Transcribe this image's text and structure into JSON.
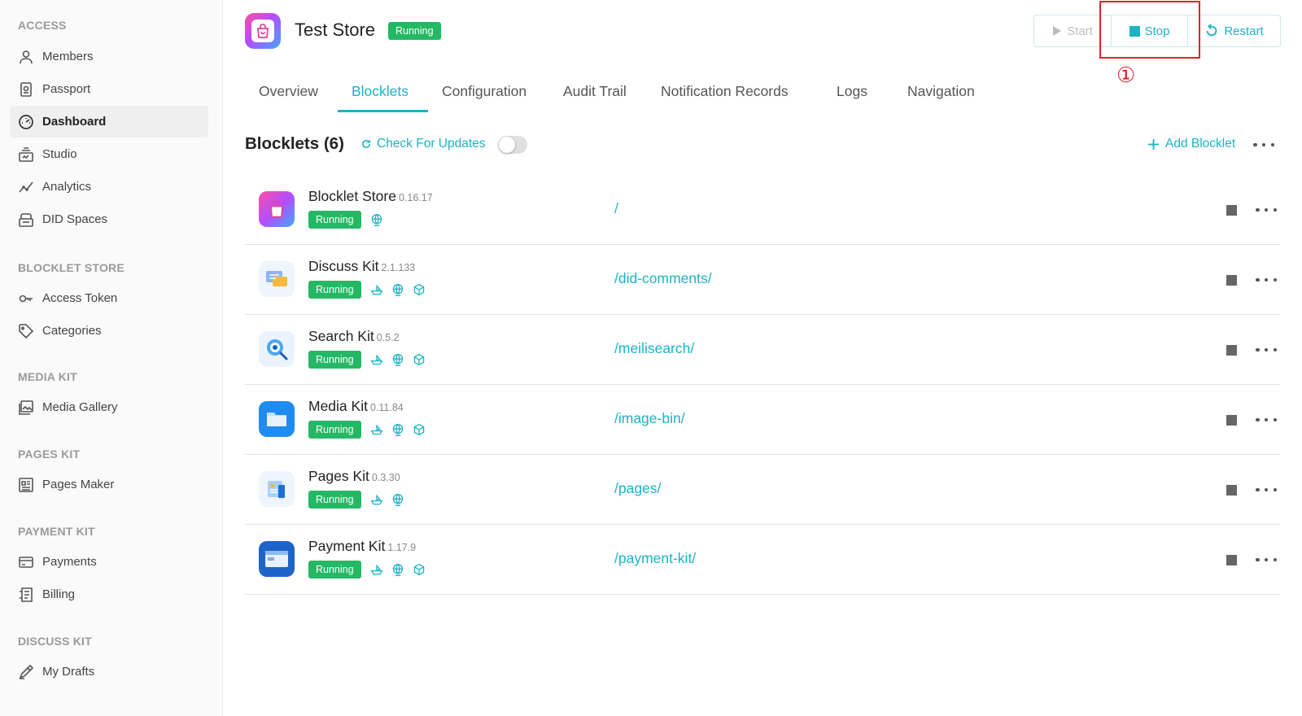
{
  "sidebar": {
    "sections": [
      {
        "header": "ACCESS",
        "items": [
          {
            "label": "Members",
            "icon": "person-icon"
          },
          {
            "label": "Passport",
            "icon": "passport-icon"
          },
          {
            "label": "Dashboard",
            "icon": "dashboard-gauge-icon",
            "active": true
          },
          {
            "label": "Studio",
            "icon": "studio-icon"
          },
          {
            "label": "Analytics",
            "icon": "analytics-icon"
          },
          {
            "label": "DID Spaces",
            "icon": "did-spaces-icon"
          }
        ]
      },
      {
        "header": "BLOCKLET STORE",
        "items": [
          {
            "label": "Access Token",
            "icon": "key-icon"
          },
          {
            "label": "Categories",
            "icon": "tag-icon"
          }
        ]
      },
      {
        "header": "MEDIA KIT",
        "items": [
          {
            "label": "Media Gallery",
            "icon": "gallery-icon"
          }
        ]
      },
      {
        "header": "PAGES KIT",
        "items": [
          {
            "label": "Pages Maker",
            "icon": "pages-icon"
          }
        ]
      },
      {
        "header": "PAYMENT KIT",
        "items": [
          {
            "label": "Payments",
            "icon": "card-icon"
          },
          {
            "label": "Billing",
            "icon": "billing-icon"
          }
        ]
      },
      {
        "header": "DISCUSS KIT",
        "items": [
          {
            "label": "My Drafts",
            "icon": "pen-icon"
          }
        ]
      }
    ]
  },
  "header": {
    "title": "Test Store",
    "status": "Running",
    "buttons": {
      "start": "Start",
      "stop": "Stop",
      "restart": "Restart"
    },
    "annotation": "①"
  },
  "tabs": [
    "Overview",
    "Blocklets",
    "Configuration",
    "Audit Trail",
    "Notification Records",
    "Logs",
    "Navigation"
  ],
  "active_tab": "Blocklets",
  "blocklets_section": {
    "title": "Blocklets (6)",
    "check_updates": "Check For Updates",
    "add_blocklet": "Add Blocklet"
  },
  "blocklets": [
    {
      "name": "Blocklet Store",
      "version": "0.16.17",
      "status": "Running",
      "path": "/",
      "icons": [
        "globe-icon"
      ]
    },
    {
      "name": "Discuss Kit",
      "version": "2.1.133",
      "status": "Running",
      "path": "/did-comments/",
      "icons": [
        "ship-icon",
        "globe-icon",
        "package-icon"
      ]
    },
    {
      "name": "Search Kit",
      "version": "0.5.2",
      "status": "Running",
      "path": "/meilisearch/",
      "icons": [
        "ship-icon",
        "globe-icon",
        "package-icon"
      ]
    },
    {
      "name": "Media Kit",
      "version": "0.11.84",
      "status": "Running",
      "path": "/image-bin/",
      "icons": [
        "ship-icon",
        "globe-icon",
        "package-icon"
      ]
    },
    {
      "name": "Pages Kit",
      "version": "0.3.30",
      "status": "Running",
      "path": "/pages/",
      "icons": [
        "ship-icon",
        "globe-icon"
      ]
    },
    {
      "name": "Payment Kit",
      "version": "1.17.9",
      "status": "Running",
      "path": "/payment-kit/",
      "icons": [
        "ship-icon",
        "globe-icon",
        "package-icon"
      ]
    }
  ],
  "colors": {
    "accent": "#1bb3c5",
    "running": "#25b864",
    "highlight": "#e0232e"
  }
}
